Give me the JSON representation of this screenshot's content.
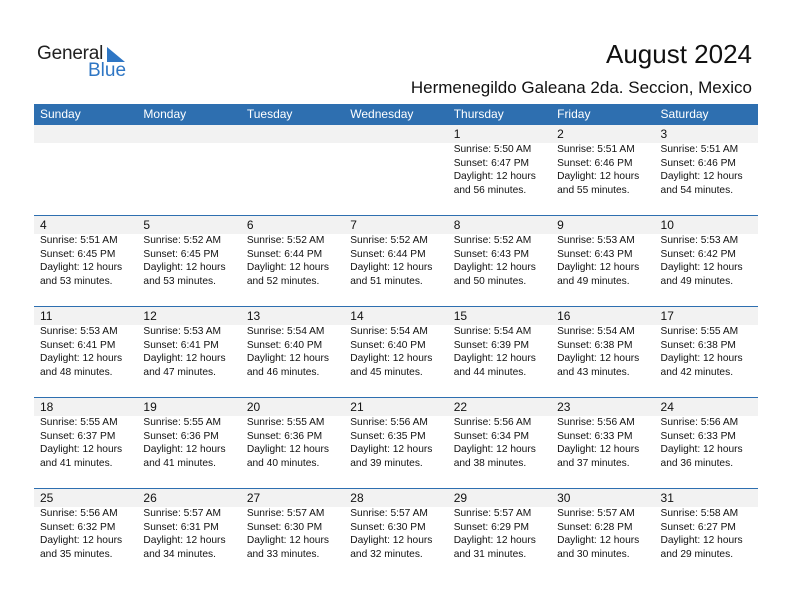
{
  "logo": {
    "word1": "General",
    "word2": "Blue"
  },
  "header": {
    "title": "August 2024",
    "subtitle": "Hermenegildo Galeana 2da. Seccion, Mexico"
  },
  "colors": {
    "accent": "#2e6fb0",
    "band": "#f2f2f2"
  },
  "days_of_week": [
    "Sunday",
    "Monday",
    "Tuesday",
    "Wednesday",
    "Thursday",
    "Friday",
    "Saturday"
  ],
  "weeks": [
    [
      null,
      null,
      null,
      null,
      {
        "day": "1",
        "sunrise": "Sunrise: 5:50 AM",
        "sunset": "Sunset: 6:47 PM",
        "daylight1": "Daylight: 12 hours",
        "daylight2": "and 56 minutes."
      },
      {
        "day": "2",
        "sunrise": "Sunrise: 5:51 AM",
        "sunset": "Sunset: 6:46 PM",
        "daylight1": "Daylight: 12 hours",
        "daylight2": "and 55 minutes."
      },
      {
        "day": "3",
        "sunrise": "Sunrise: 5:51 AM",
        "sunset": "Sunset: 6:46 PM",
        "daylight1": "Daylight: 12 hours",
        "daylight2": "and 54 minutes."
      }
    ],
    [
      {
        "day": "4",
        "sunrise": "Sunrise: 5:51 AM",
        "sunset": "Sunset: 6:45 PM",
        "daylight1": "Daylight: 12 hours",
        "daylight2": "and 53 minutes."
      },
      {
        "day": "5",
        "sunrise": "Sunrise: 5:52 AM",
        "sunset": "Sunset: 6:45 PM",
        "daylight1": "Daylight: 12 hours",
        "daylight2": "and 53 minutes."
      },
      {
        "day": "6",
        "sunrise": "Sunrise: 5:52 AM",
        "sunset": "Sunset: 6:44 PM",
        "daylight1": "Daylight: 12 hours",
        "daylight2": "and 52 minutes."
      },
      {
        "day": "7",
        "sunrise": "Sunrise: 5:52 AM",
        "sunset": "Sunset: 6:44 PM",
        "daylight1": "Daylight: 12 hours",
        "daylight2": "and 51 minutes."
      },
      {
        "day": "8",
        "sunrise": "Sunrise: 5:52 AM",
        "sunset": "Sunset: 6:43 PM",
        "daylight1": "Daylight: 12 hours",
        "daylight2": "and 50 minutes."
      },
      {
        "day": "9",
        "sunrise": "Sunrise: 5:53 AM",
        "sunset": "Sunset: 6:43 PM",
        "daylight1": "Daylight: 12 hours",
        "daylight2": "and 49 minutes."
      },
      {
        "day": "10",
        "sunrise": "Sunrise: 5:53 AM",
        "sunset": "Sunset: 6:42 PM",
        "daylight1": "Daylight: 12 hours",
        "daylight2": "and 49 minutes."
      }
    ],
    [
      {
        "day": "11",
        "sunrise": "Sunrise: 5:53 AM",
        "sunset": "Sunset: 6:41 PM",
        "daylight1": "Daylight: 12 hours",
        "daylight2": "and 48 minutes."
      },
      {
        "day": "12",
        "sunrise": "Sunrise: 5:53 AM",
        "sunset": "Sunset: 6:41 PM",
        "daylight1": "Daylight: 12 hours",
        "daylight2": "and 47 minutes."
      },
      {
        "day": "13",
        "sunrise": "Sunrise: 5:54 AM",
        "sunset": "Sunset: 6:40 PM",
        "daylight1": "Daylight: 12 hours",
        "daylight2": "and 46 minutes."
      },
      {
        "day": "14",
        "sunrise": "Sunrise: 5:54 AM",
        "sunset": "Sunset: 6:40 PM",
        "daylight1": "Daylight: 12 hours",
        "daylight2": "and 45 minutes."
      },
      {
        "day": "15",
        "sunrise": "Sunrise: 5:54 AM",
        "sunset": "Sunset: 6:39 PM",
        "daylight1": "Daylight: 12 hours",
        "daylight2": "and 44 minutes."
      },
      {
        "day": "16",
        "sunrise": "Sunrise: 5:54 AM",
        "sunset": "Sunset: 6:38 PM",
        "daylight1": "Daylight: 12 hours",
        "daylight2": "and 43 minutes."
      },
      {
        "day": "17",
        "sunrise": "Sunrise: 5:55 AM",
        "sunset": "Sunset: 6:38 PM",
        "daylight1": "Daylight: 12 hours",
        "daylight2": "and 42 minutes."
      }
    ],
    [
      {
        "day": "18",
        "sunrise": "Sunrise: 5:55 AM",
        "sunset": "Sunset: 6:37 PM",
        "daylight1": "Daylight: 12 hours",
        "daylight2": "and 41 minutes."
      },
      {
        "day": "19",
        "sunrise": "Sunrise: 5:55 AM",
        "sunset": "Sunset: 6:36 PM",
        "daylight1": "Daylight: 12 hours",
        "daylight2": "and 41 minutes."
      },
      {
        "day": "20",
        "sunrise": "Sunrise: 5:55 AM",
        "sunset": "Sunset: 6:36 PM",
        "daylight1": "Daylight: 12 hours",
        "daylight2": "and 40 minutes."
      },
      {
        "day": "21",
        "sunrise": "Sunrise: 5:56 AM",
        "sunset": "Sunset: 6:35 PM",
        "daylight1": "Daylight: 12 hours",
        "daylight2": "and 39 minutes."
      },
      {
        "day": "22",
        "sunrise": "Sunrise: 5:56 AM",
        "sunset": "Sunset: 6:34 PM",
        "daylight1": "Daylight: 12 hours",
        "daylight2": "and 38 minutes."
      },
      {
        "day": "23",
        "sunrise": "Sunrise: 5:56 AM",
        "sunset": "Sunset: 6:33 PM",
        "daylight1": "Daylight: 12 hours",
        "daylight2": "and 37 minutes."
      },
      {
        "day": "24",
        "sunrise": "Sunrise: 5:56 AM",
        "sunset": "Sunset: 6:33 PM",
        "daylight1": "Daylight: 12 hours",
        "daylight2": "and 36 minutes."
      }
    ],
    [
      {
        "day": "25",
        "sunrise": "Sunrise: 5:56 AM",
        "sunset": "Sunset: 6:32 PM",
        "daylight1": "Daylight: 12 hours",
        "daylight2": "and 35 minutes."
      },
      {
        "day": "26",
        "sunrise": "Sunrise: 5:57 AM",
        "sunset": "Sunset: 6:31 PM",
        "daylight1": "Daylight: 12 hours",
        "daylight2": "and 34 minutes."
      },
      {
        "day": "27",
        "sunrise": "Sunrise: 5:57 AM",
        "sunset": "Sunset: 6:30 PM",
        "daylight1": "Daylight: 12 hours",
        "daylight2": "and 33 minutes."
      },
      {
        "day": "28",
        "sunrise": "Sunrise: 5:57 AM",
        "sunset": "Sunset: 6:30 PM",
        "daylight1": "Daylight: 12 hours",
        "daylight2": "and 32 minutes."
      },
      {
        "day": "29",
        "sunrise": "Sunrise: 5:57 AM",
        "sunset": "Sunset: 6:29 PM",
        "daylight1": "Daylight: 12 hours",
        "daylight2": "and 31 minutes."
      },
      {
        "day": "30",
        "sunrise": "Sunrise: 5:57 AM",
        "sunset": "Sunset: 6:28 PM",
        "daylight1": "Daylight: 12 hours",
        "daylight2": "and 30 minutes."
      },
      {
        "day": "31",
        "sunrise": "Sunrise: 5:58 AM",
        "sunset": "Sunset: 6:27 PM",
        "daylight1": "Daylight: 12 hours",
        "daylight2": "and 29 minutes."
      }
    ]
  ]
}
